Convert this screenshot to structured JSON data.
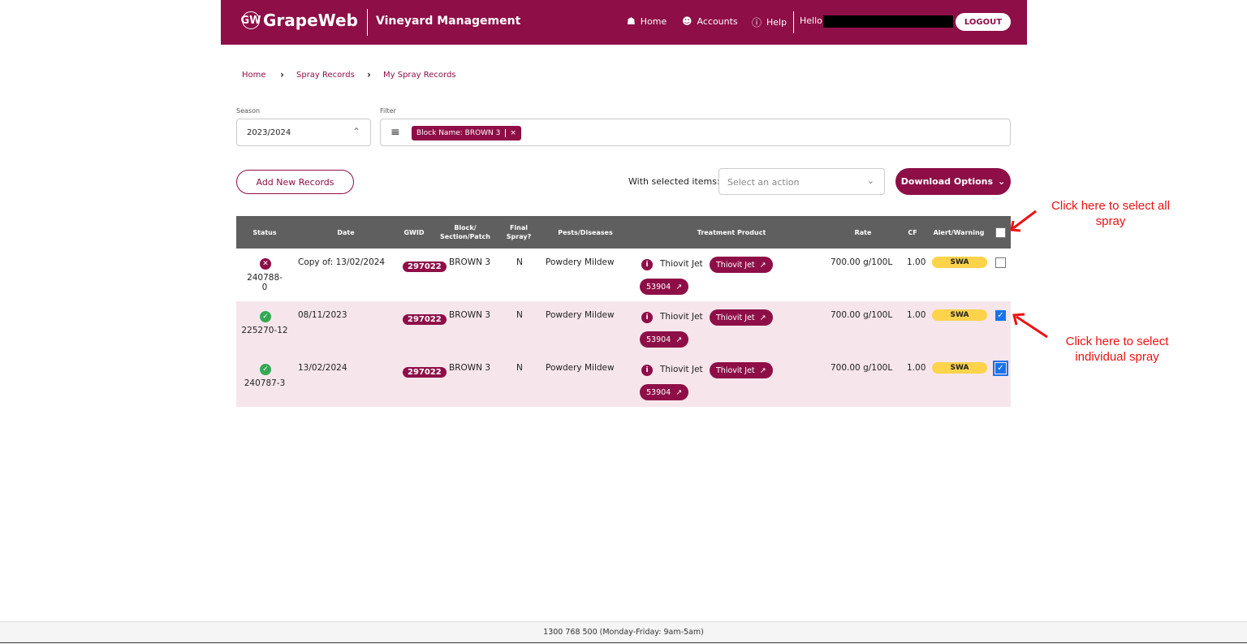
{
  "header": {
    "logo_mark": "GW",
    "brand": "GrapeWeb",
    "subtitle": "Vineyard Management",
    "nav": [
      {
        "label": "Home",
        "icon": "home-icon"
      },
      {
        "label": "Accounts",
        "icon": "account-icon"
      },
      {
        "label": "Help",
        "icon": "help-icon"
      }
    ],
    "hello": "Hello,",
    "logout": "LOGOUT"
  },
  "breadcrumb": [
    "Home",
    "Spray Records",
    "My Spray Records"
  ],
  "season": {
    "label": "Season",
    "value": "2023/2024"
  },
  "filter": {
    "label": "Filter",
    "chip": "Block Name: BROWN 3",
    "chip_close": "×"
  },
  "actions": {
    "add": "Add New Records",
    "with_selected": "With selected items:",
    "action_placeholder": "Select an action",
    "download": "Download Options"
  },
  "table": {
    "headers": {
      "status": "Status",
      "date": "Date",
      "gwid": "GWID",
      "block1": "Block/",
      "block2": "Section/Patch",
      "final1": "Final",
      "final2": "Spray?",
      "pests": "Pests/Diseases",
      "treatment": "Treatment Product",
      "rate": "Rate",
      "cf": "CF",
      "alert": "Alert/Warning"
    },
    "rows": [
      {
        "status": "error",
        "id": "240788-0",
        "date": "Copy of: 13/02/2024",
        "gwid": "297022",
        "block": "BROWN 3",
        "final": "N",
        "pests": "Powdery Mildew",
        "product": "Thiovit Jet",
        "link1": "Thiovit Jet",
        "link2": "53904",
        "rate": "700.00 g/100L",
        "cf": "1.00",
        "alert": "SWA",
        "checked": false
      },
      {
        "status": "ok",
        "id": "225270-12",
        "date": "08/11/2023",
        "gwid": "297022",
        "block": "BROWN 3",
        "final": "N",
        "pests": "Powdery Mildew",
        "product": "Thiovit Jet",
        "link1": "Thiovit Jet",
        "link2": "53904",
        "rate": "700.00 g/100L",
        "cf": "1.00",
        "alert": "SWA",
        "checked": true
      },
      {
        "status": "ok",
        "id": "240787-3",
        "date": "13/02/2024",
        "gwid": "297022",
        "block": "BROWN 3",
        "final": "N",
        "pests": "Powdery Mildew",
        "product": "Thiovit Jet",
        "link1": "Thiovit Jet",
        "link2": "53904",
        "rate": "700.00 g/100L",
        "cf": "1.00",
        "alert": "SWA",
        "checked": true
      }
    ]
  },
  "annotations": {
    "select_all": "Click here to select all spray",
    "select_individual": "Click here to select individual spray"
  },
  "footer": "1300 768 500 (Monday-Friday: 9am-5am)",
  "colors": {
    "brand": "#8e0e47",
    "ok": "#34a853",
    "error": "#8e0e47",
    "alert": "#fdd34b",
    "annotation": "#e11111",
    "checkbox": "#1a73e8"
  }
}
